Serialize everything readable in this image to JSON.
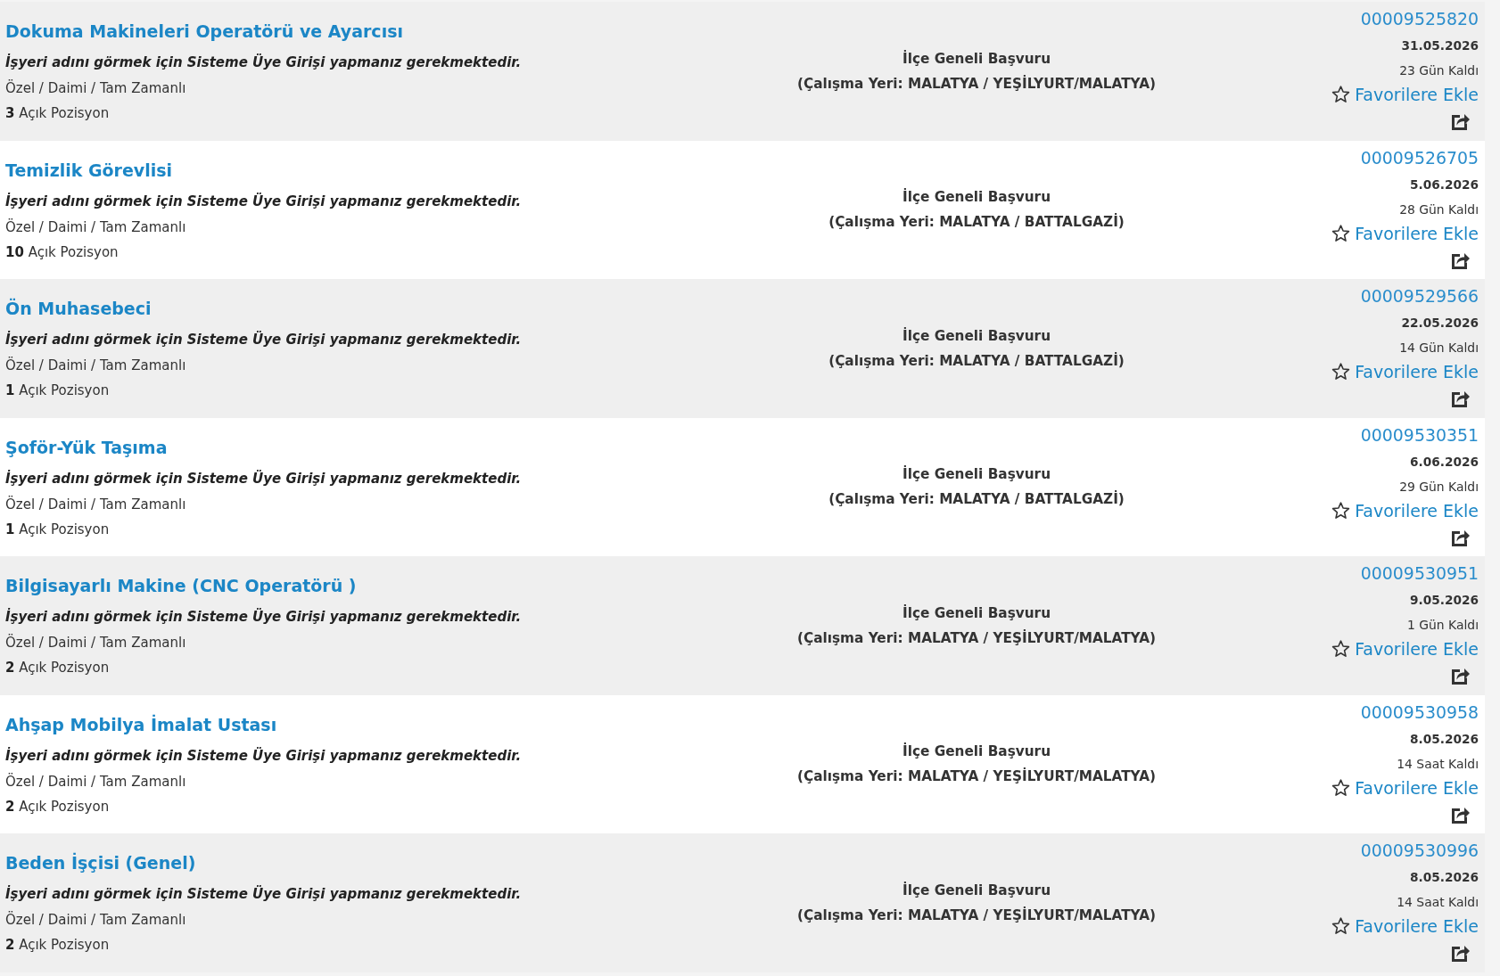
{
  "listings": [
    {
      "title": "Dokuma Makineleri Operatörü ve Ayarcısı",
      "employer_notice": "İşyeri adını görmek için Sisteme Üye Girişi yapmanız gerekmektedir.",
      "employment_type": "Özel / Daimi / Tam Zamanlı",
      "positions": "**3** Açık Pozisyon",
      "application_scope": "İlçe Geneli Başvuru",
      "work_location": "(Çalışma Yeri: MALATYA / YEŞİLYURT/MALATYA)",
      "listing_number": "00009525820",
      "deadline": "31.05.2026",
      "remaining": "23 Gün Kaldı",
      "favorite_label": "Favorilere Ekle"
    },
    {
      "title": "Temizlik Görevlisi",
      "employer_notice": "İşyeri adını görmek için Sisteme Üye Girişi yapmanız gerekmektedir.",
      "employment_type": "Özel / Daimi / Tam Zamanlı",
      "positions": "**10** Açık Pozisyon",
      "application_scope": "İlçe Geneli Başvuru",
      "work_location": "(Çalışma Yeri: MALATYA / BATTALGAZİ)",
      "listing_number": "00009526705",
      "deadline": "5.06.2026",
      "remaining": "28 Gün Kaldı",
      "favorite_label": "Favorilere Ekle"
    },
    {
      "title": "Ön Muhasebeci",
      "employer_notice": "İşyeri adını görmek için Sisteme Üye Girişi yapmanız gerekmektedir.",
      "employment_type": "Özel / Daimi / Tam Zamanlı",
      "positions": "**1** Açık Pozisyon",
      "application_scope": "İlçe Geneli Başvuru",
      "work_location": "(Çalışma Yeri: MALATYA / BATTALGAZİ)",
      "listing_number": "00009529566",
      "deadline": "22.05.2026",
      "remaining": "14 Gün Kaldı",
      "favorite_label": "Favorilere Ekle"
    },
    {
      "title": "Şoför-Yük Taşıma",
      "employer_notice": "İşyeri adını görmek için Sisteme Üye Girişi yapmanız gerekmektedir.",
      "employment_type": "Özel / Daimi / Tam Zamanlı",
      "positions": "**1** Açık Pozisyon",
      "application_scope": "İlçe Geneli Başvuru",
      "work_location": "(Çalışma Yeri: MALATYA / BATTALGAZİ)",
      "listing_number": "00009530351",
      "deadline": "6.06.2026",
      "remaining": "29 Gün Kaldı",
      "favorite_label": "Favorilere Ekle"
    },
    {
      "title": "Bilgisayarlı Makine (CNC Operatörü )",
      "employer_notice": "İşyeri adını görmek için Sisteme Üye Girişi yapmanız gerekmektedir.",
      "employment_type": "Özel / Daimi / Tam Zamanlı",
      "positions": "**2** Açık Pozisyon",
      "application_scope": "İlçe Geneli Başvuru",
      "work_location": "(Çalışma Yeri: MALATYA / YEŞİLYURT/MALATYA)",
      "listing_number": "00009530951",
      "deadline": "9.05.2026",
      "remaining": "1 Gün Kaldı",
      "favorite_label": "Favorilere Ekle"
    },
    {
      "title": "Ahşap Mobilya İmalat Ustası",
      "employer_notice": "İşyeri adını görmek için Sisteme Üye Girişi yapmanız gerekmektedir.",
      "employment_type": "Özel / Daimi / Tam Zamanlı",
      "positions": "**2** Açık Pozisyon",
      "application_scope": "İlçe Geneli Başvuru",
      "work_location": "(Çalışma Yeri: MALATYA / YEŞİLYURT/MALATYA)",
      "listing_number": "00009530958",
      "deadline": "8.05.2026",
      "remaining": "14 Saat Kaldı",
      "favorite_label": "Favorilere Ekle"
    },
    {
      "title": "Beden İşçisi (Genel)",
      "employer_notice": "İşyeri adını görmek için Sisteme Üye Girişi yapmanız gerekmektedir.",
      "employment_type": "Özel / Daimi / Tam Zamanlı",
      "positions": "**2** Açık Pozisyon",
      "application_scope": "İlçe Geneli Başvuru",
      "work_location": "(Çalışma Yeri: MALATYA / YEŞİLYURT/MALATYA)",
      "listing_number": "00009530996",
      "deadline": "8.05.2026",
      "remaining": "14 Saat Kaldı",
      "favorite_label": "Favorilere Ekle"
    }
  ]
}
